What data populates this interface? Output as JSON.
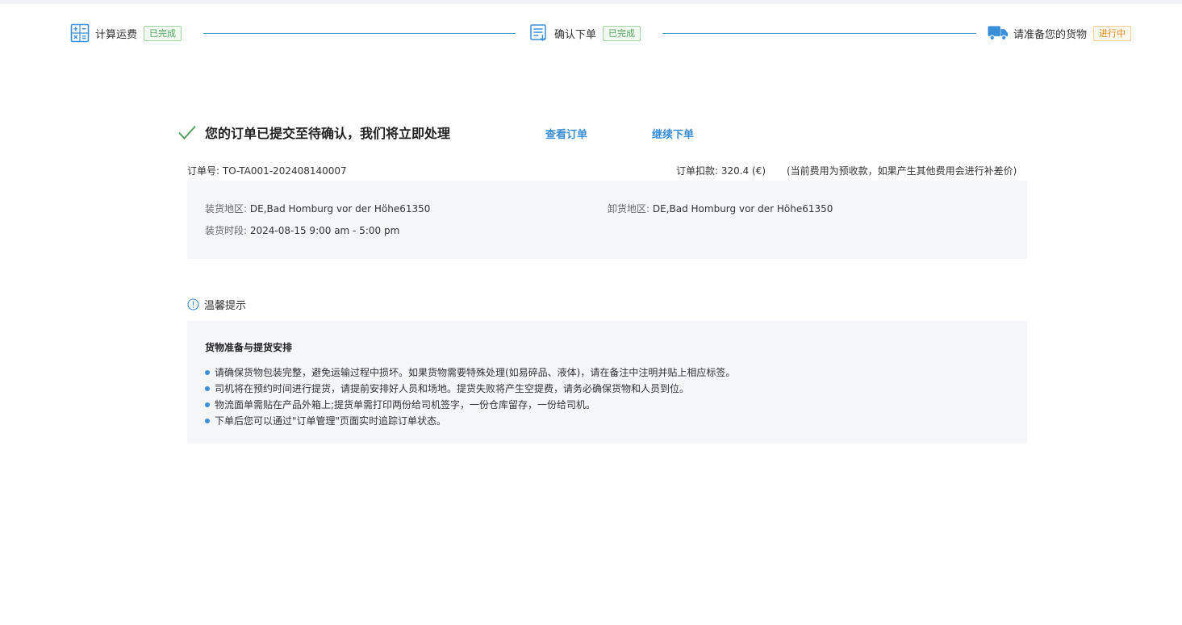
{
  "steps": [
    {
      "label": "计算运费",
      "status": "已完成",
      "icon": "calculator-icon"
    },
    {
      "label": "确认下单",
      "status": "已完成",
      "icon": "order-form-icon"
    },
    {
      "label": "请准备您的货物",
      "status": "进行中",
      "icon": "truck-icon"
    }
  ],
  "colors": {
    "accent": "#3b8ed8",
    "success": "#52a35e",
    "progress": "#e08a1e",
    "panel_bg": "#f5f6f9"
  },
  "result": {
    "title": "您的订单已提交至待确认，我们将立即处理",
    "view_order": "查看订单",
    "continue_order": "继续下单"
  },
  "order": {
    "number_label": "订单号:",
    "number": "TO-TA001-202408140007",
    "deduction_label": "订单扣款:",
    "deduction": "320.4 (€)",
    "note": "(当前费用为预收款，如果产生其他费用会进行补差价)"
  },
  "details": {
    "loading_area_label": "装货地区:",
    "loading_area": "DE,Bad Homburg vor der Höhe61350",
    "unloading_area_label": "卸货地区:",
    "unloading_area": "DE,Bad Homburg vor der Höhe61350",
    "loading_time_label": "装货时段:",
    "loading_time": "2024-08-15 9:00 am - 5:00 pm"
  },
  "tips": {
    "heading": "温馨提示",
    "title": "货物准备与提货安排",
    "items": [
      "请确保货物包装完整，避免运输过程中损坏。如果货物需要特殊处理(如易碎品、液体)，请在备注中注明并贴上相应标签。",
      "司机将在预约时间进行提货，请提前安排好人员和场地。提货失败将产生空提费，请务必确保货物和人员到位。",
      "物流面单需贴在产品外箱上;提货单需打印两份给司机签字，一份仓库留存，一份给司机。",
      "下单后您可以通过\"订单管理\"页面实时追踪订单状态。"
    ]
  }
}
